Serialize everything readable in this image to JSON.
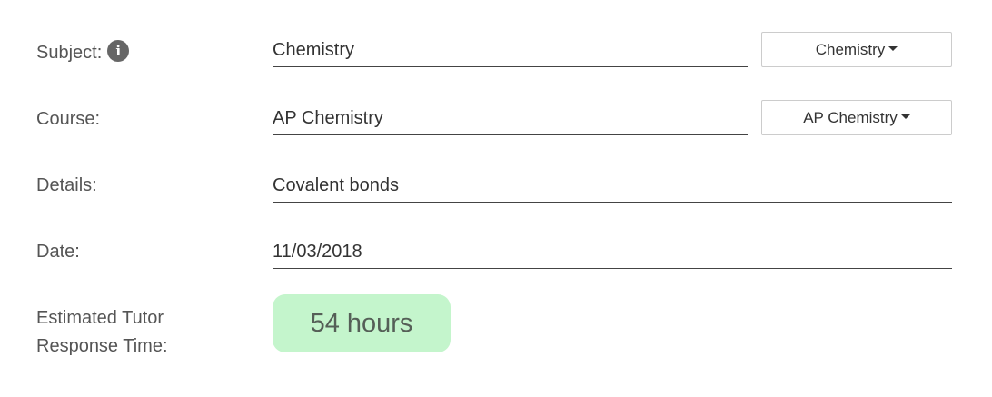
{
  "form": {
    "subject": {
      "label": "Subject:",
      "value": "Chemistry",
      "dropdown": "Chemistry"
    },
    "course": {
      "label": "Course:",
      "value": "AP Chemistry",
      "dropdown": "AP Chemistry"
    },
    "details": {
      "label": "Details:",
      "value": "Covalent bonds"
    },
    "date": {
      "label": "Date:",
      "value": "11/03/2018"
    },
    "response_time": {
      "label_line1": "Estimated Tutor",
      "label_line2": "Response Time:",
      "value": "54 hours"
    }
  },
  "icons": {
    "subject_info": "info-icon"
  },
  "colors": {
    "badge_background": "#c4f5cc",
    "badge_text": "#555f57",
    "underline": "#444444",
    "info_icon": "#666666"
  }
}
